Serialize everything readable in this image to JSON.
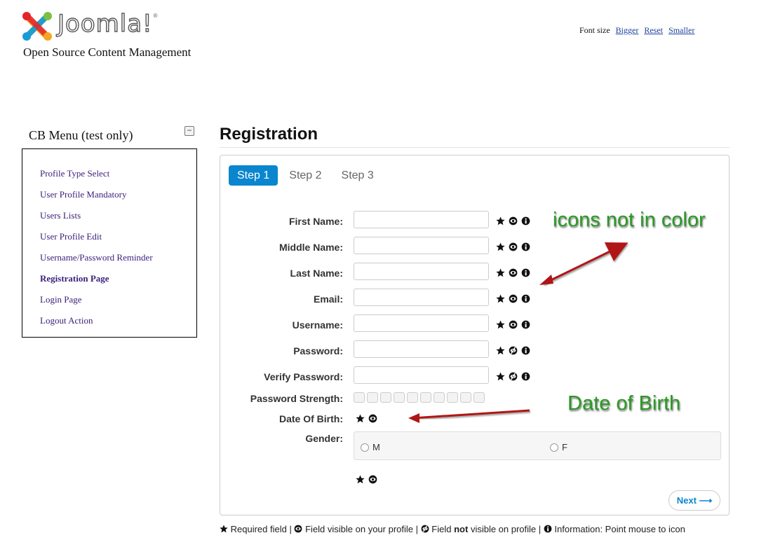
{
  "header": {
    "tagline": "Open Source Content Management",
    "font_size_label": "Font size",
    "bigger": "Bigger",
    "reset": "Reset",
    "smaller": "Smaller"
  },
  "sidebar": {
    "title": "CB Menu (test only)",
    "toggle": "−",
    "items": [
      {
        "label": "Profile Type Select"
      },
      {
        "label": "User Profile Mandatory"
      },
      {
        "label": "Users Lists"
      },
      {
        "label": "User Profile Edit"
      },
      {
        "label": "Username/Password Reminder"
      },
      {
        "label": "Registration Page",
        "active": true
      },
      {
        "label": "Login Page"
      },
      {
        "label": "Logout Action"
      }
    ]
  },
  "main": {
    "title": "Registration",
    "steps": [
      {
        "label": "Step 1",
        "active": true
      },
      {
        "label": "Step 2"
      },
      {
        "label": "Step 3"
      }
    ],
    "fields": [
      {
        "label": "First Name:",
        "value": "",
        "icons": [
          "star-icon",
          "eye-icon",
          "info-icon"
        ]
      },
      {
        "label": "Middle Name:",
        "value": "",
        "icons": [
          "star-icon",
          "eye-icon",
          "info-icon"
        ]
      },
      {
        "label": "Last Name:",
        "value": "",
        "icons": [
          "star-icon",
          "eye-icon",
          "info-icon"
        ]
      },
      {
        "label": "Email:",
        "value": "",
        "icons": [
          "star-icon",
          "eye-icon",
          "info-icon"
        ]
      },
      {
        "label": "Username:",
        "value": "",
        "icons": [
          "star-icon",
          "eye-icon",
          "info-icon"
        ]
      },
      {
        "label": "Password:",
        "value": "",
        "icons": [
          "star-icon",
          "eye-slash-icon",
          "info-icon"
        ]
      },
      {
        "label": "Verify Password:",
        "value": "",
        "icons": [
          "star-icon",
          "eye-slash-icon",
          "info-icon"
        ]
      }
    ],
    "password_strength": {
      "label": "Password Strength:",
      "segments": 10,
      "filled": 0
    },
    "date_of_birth": {
      "label": "Date Of Birth:",
      "icons": [
        "star-icon",
        "eye-icon"
      ]
    },
    "gender": {
      "label": "Gender:",
      "options": [
        "M",
        "F"
      ],
      "icons": [
        "star-icon",
        "eye-icon"
      ]
    },
    "next_label": "Next ⟶"
  },
  "legend": {
    "required": "Required field",
    "sep": "|",
    "visible": "Field visible on your profile",
    "not_visible_pre": "Field",
    "not_visible_bold": "not",
    "not_visible_post": "visible on profile",
    "info": "Information: Point mouse to icon"
  },
  "annotations": {
    "icons_note": "icons not in color",
    "dob_note": "Date of Birth"
  },
  "colors": {
    "accent": "#0a86cf",
    "annotation_text": "#2a9a24",
    "annotation_arrow": "#b01515",
    "menu_link": "#3a1f7a"
  }
}
